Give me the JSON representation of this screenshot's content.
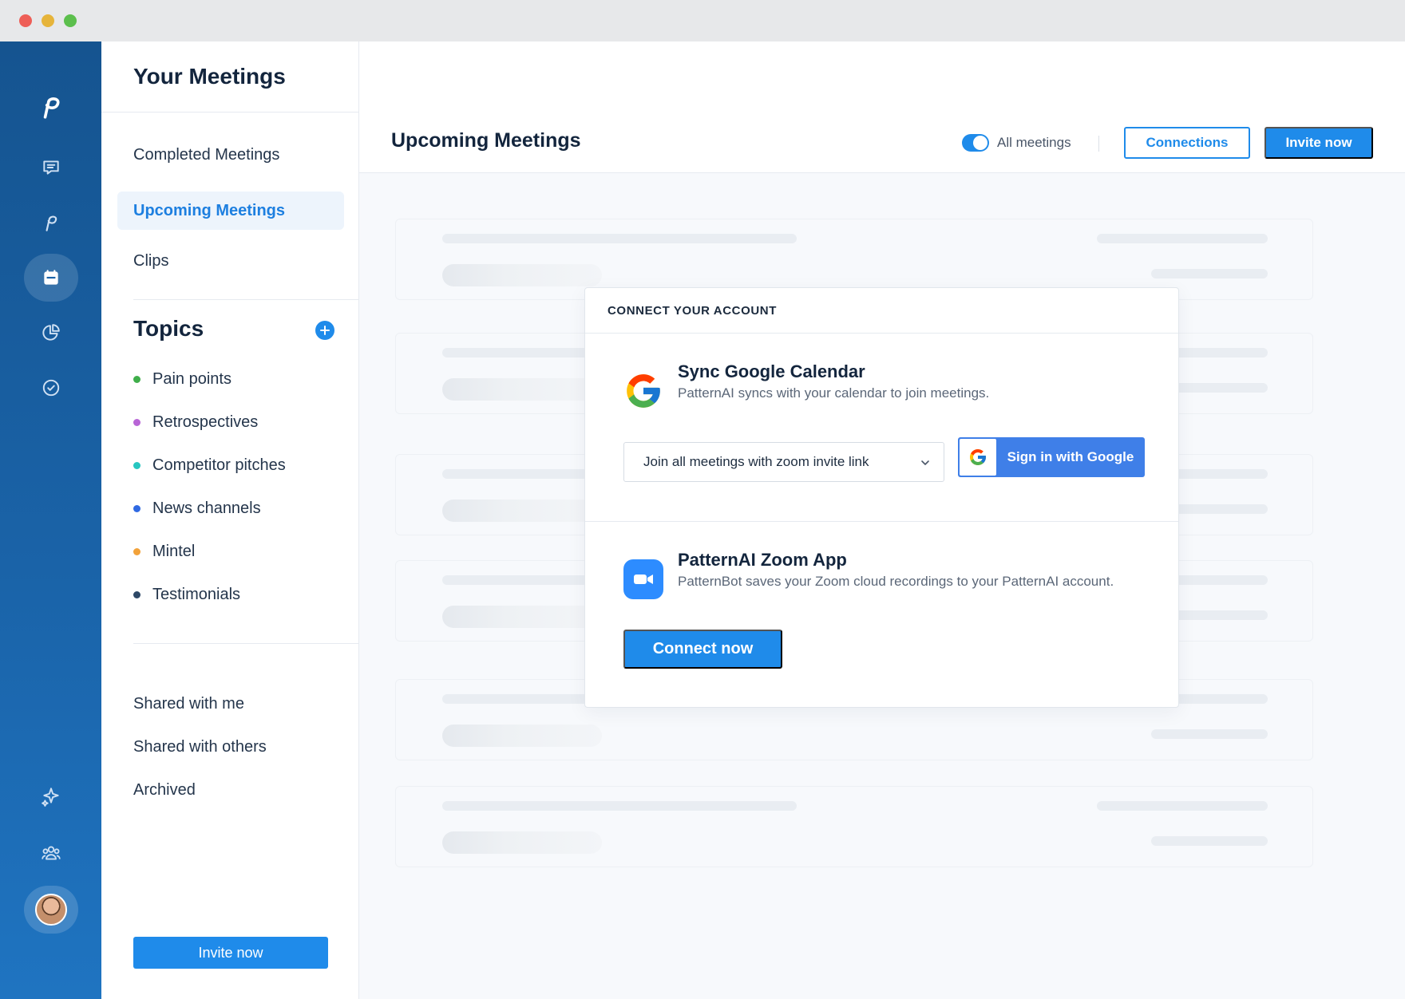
{
  "window": {
    "traffic_lights": [
      "close",
      "minimize",
      "maximize"
    ]
  },
  "rail": {
    "logo_icon": "pattern-logo-icon",
    "items": [
      {
        "icon": "chat-icon"
      },
      {
        "icon": "pattern-icon"
      },
      {
        "icon": "calendar-icon",
        "active": true
      },
      {
        "icon": "pie-chart-icon"
      },
      {
        "icon": "check-circle-icon"
      },
      {
        "icon": "sparkles-icon"
      },
      {
        "icon": "team-icon"
      },
      {
        "icon": "gear-icon"
      }
    ],
    "avatar_icon": "user-avatar"
  },
  "sidebar": {
    "title": "Your Meetings",
    "nav": [
      {
        "label": "Completed Meetings"
      },
      {
        "label": "Upcoming Meetings",
        "active": true
      },
      {
        "label": "Clips"
      }
    ],
    "topics_title": "Topics",
    "topics": [
      {
        "label": "Pain points",
        "color": "#3fae4a"
      },
      {
        "label": "Retrospectives",
        "color": "#b865d6"
      },
      {
        "label": "Competitor pitches",
        "color": "#27c6c0"
      },
      {
        "label": "News channels",
        "color": "#2f69e2"
      },
      {
        "label": "Mintel",
        "color": "#f2a23a"
      },
      {
        "label": "Testimonials",
        "color": "#2d4866"
      }
    ],
    "bottom_nav": [
      {
        "label": "Shared with me"
      },
      {
        "label": "Shared with others"
      },
      {
        "label": "Archived"
      }
    ],
    "invite_label": "Invite now"
  },
  "main": {
    "title": "Upcoming Meetings",
    "toggle": {
      "label": "All meetings",
      "on": true
    },
    "connections_label": "Connections",
    "invite_label": "Invite now"
  },
  "modal": {
    "header": "CONNECT YOUR ACCOUNT",
    "google": {
      "title": "Sync Google Calendar",
      "description": "PatternAI syncs with your calendar to join meetings.",
      "select_value": "Join all meetings with zoom invite link",
      "signin_label": "Sign in with Google"
    },
    "zoom": {
      "title": "PatternAI Zoom App",
      "description": "PatternBot saves your Zoom cloud recordings to your PatternAI account.",
      "connect_label": "Connect now"
    }
  },
  "colors": {
    "accent": "#1f8bea",
    "rail": "#1a63a8",
    "google_blue": "#3f7fe8",
    "zoom_blue": "#2d8cff"
  }
}
